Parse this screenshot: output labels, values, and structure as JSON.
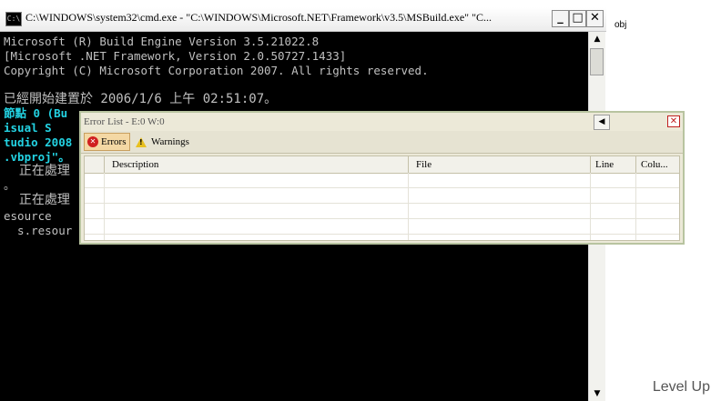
{
  "cmd": {
    "icon_text": "C:\\",
    "title": "C:\\WINDOWS\\system32\\cmd.exe - \"C:\\WINDOWS\\Microsoft.NET\\Framework\\v3.5\\MSBuild.exe\" \"C...",
    "buttons": {
      "minimize": "_",
      "maximize": "□",
      "close": "✕"
    },
    "lines": [
      "Microsoft (R) Build Engine Version 3.5.21022.8",
      "[Microsoft .NET Framework, Version 2.0.50727.1433]",
      "Copyright (C) Microsoft Corporation 2007. All rights reserved.",
      "已經開始建置於 2006/1/6 上午 02:51:07。",
      "節點 0 (Bu",
      "isual S",
      "tudio 2008",
      ".vbproj\"。",
      "  正在處理",
      "。",
      "  正在處理",
      "esource",
      "  s.resour"
    ]
  },
  "side_label": "obj",
  "watermark": "Level Up",
  "error_list": {
    "title": "Error List - E:0 W:0",
    "pin_icon": "◀",
    "close": "✕",
    "toolbar": {
      "errors_label": "Errors",
      "warnings_label": "Warnings"
    },
    "columns": [
      "",
      "Description",
      "File",
      "Line",
      "Colu..."
    ],
    "rows": [
      [],
      [],
      [],
      []
    ]
  },
  "colors": {
    "console_bg": "#000000",
    "console_text": "#c0c0c0",
    "console_cyan": "#23d3e3",
    "panel_bg": "#ece9d8"
  }
}
